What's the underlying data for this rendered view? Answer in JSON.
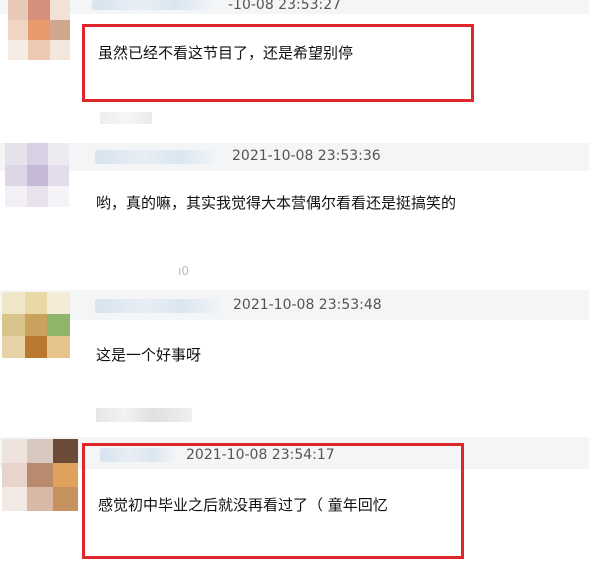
{
  "comments": [
    {
      "time": "-10-08 23:53:27",
      "text": "虽然已经不看这节目了，还是希望别停"
    },
    {
      "time": "2021-10-08 23:53:36",
      "text": "哟，真的嘛，其实我觉得大本营偶尔看看还是挺搞笑的"
    },
    {
      "time": "2021-10-08 23:53:48",
      "text": "这是一个好事呀"
    },
    {
      "time": "2021-10-08 23:54:17",
      "text": "感觉初中毕业之后就没再看过了（ 童年回忆"
    }
  ],
  "colors": {
    "highlight_box": "#e0262d",
    "header_band": "#f4f5f7"
  }
}
